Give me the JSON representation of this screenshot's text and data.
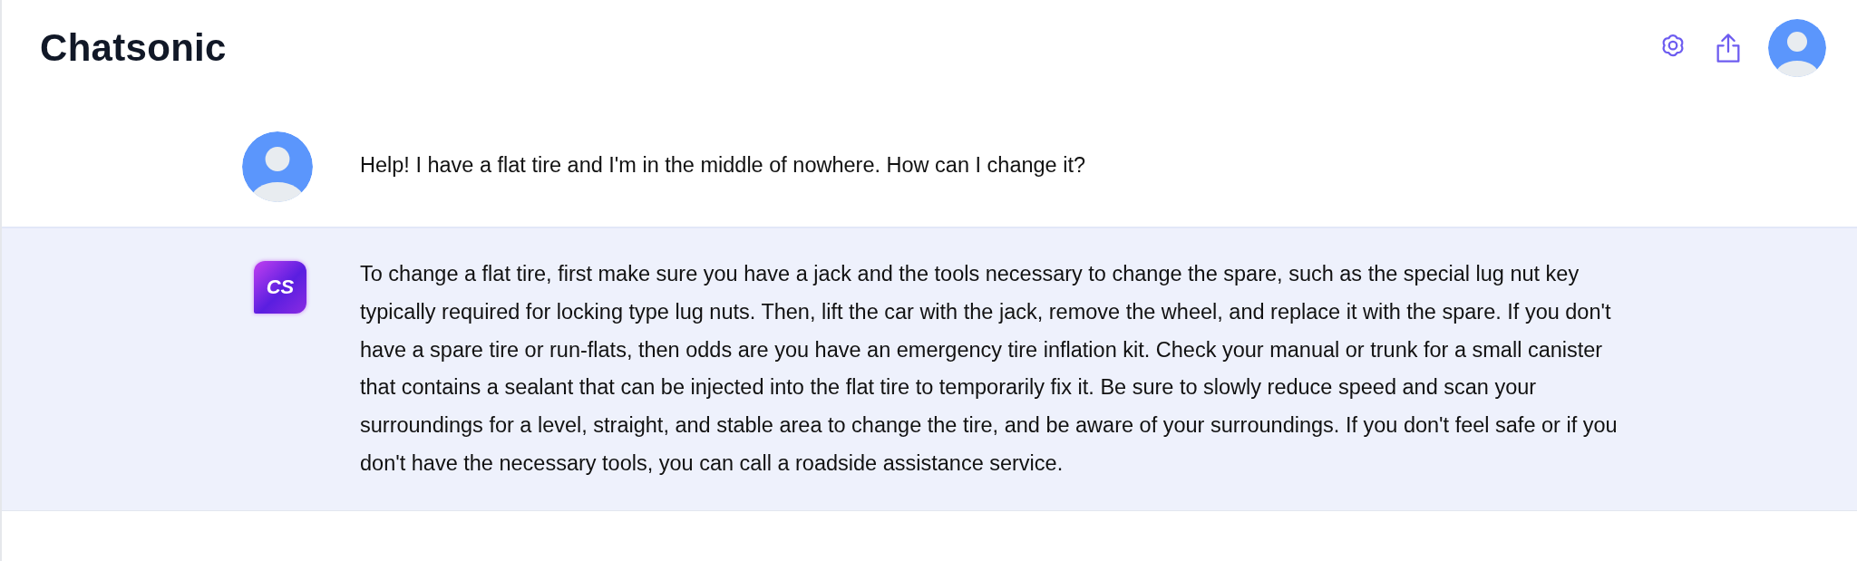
{
  "header": {
    "title": "Chatsonic"
  },
  "messages": [
    {
      "kind": "user",
      "text": "Help! I have a flat tire and I'm in the middle of nowhere. How can I change it?"
    },
    {
      "kind": "bot",
      "logo": "CS",
      "text": "To change a flat tire, first make sure you have a jack and the tools necessary to change the spare, such as the special lug nut key typically required for locking type lug nuts. Then, lift the car with the jack, remove the wheel, and replace it with the spare. If you don't have a spare tire or run-flats, then odds are you have an emergency tire inflation kit. Check your manual or trunk for a small canister that contains a sealant that can be injected into the flat tire to temporarily fix it. Be sure to slowly reduce speed and scan your surroundings for a level, straight, and stable area to change the tire, and be aware of your surroundings. If you don't feel safe or if you don't have the necessary tools, you can call a roadside assistance service."
    }
  ]
}
